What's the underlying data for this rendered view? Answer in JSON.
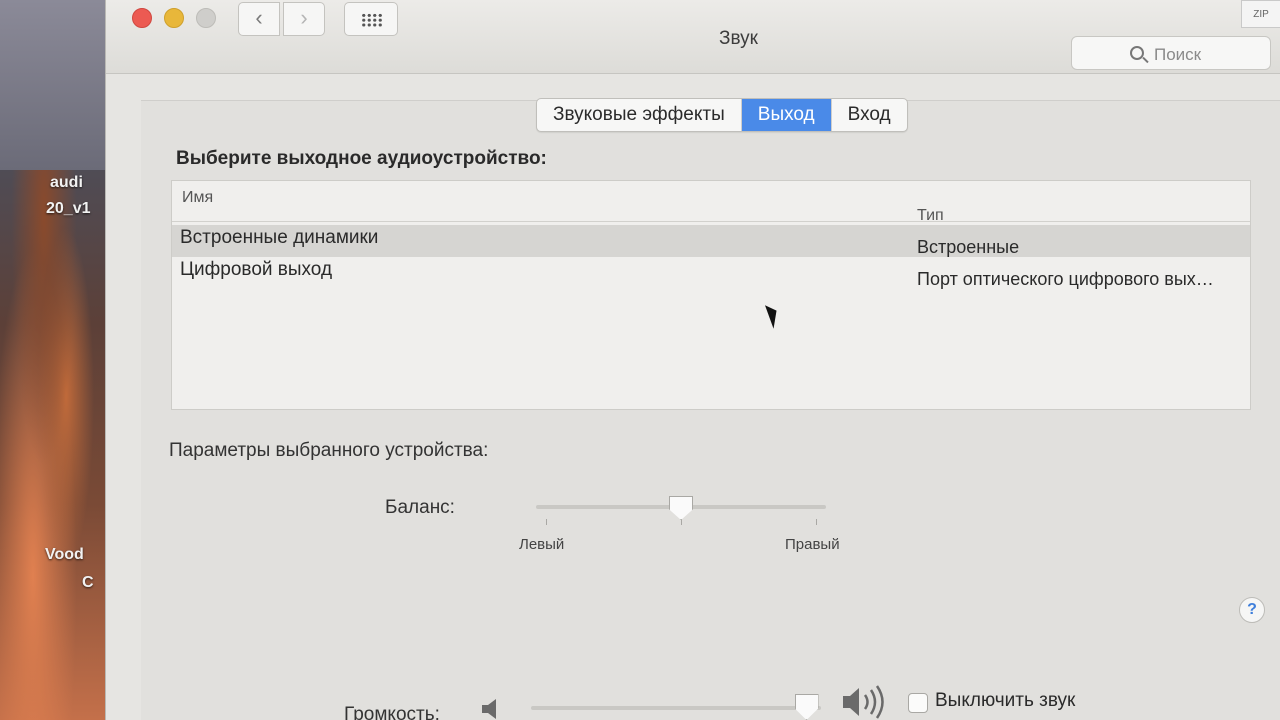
{
  "desktop": {
    "icon_label_line1": "audi",
    "icon_label_line2": "20_v1",
    "icon2_label_line1": "Vood",
    "icon2_label_line2": "C"
  },
  "window": {
    "title": "Звук",
    "search_placeholder": "Поиск",
    "zip_badge": "ZIP",
    "back_glyph": "‹",
    "forward_glyph": "›"
  },
  "tabs": [
    {
      "label": "Звуковые эффекты",
      "active": false
    },
    {
      "label": "Выход",
      "active": true
    },
    {
      "label": "Вход",
      "active": false
    }
  ],
  "output": {
    "section_title": "Выберите выходное аудиоустройство:",
    "columns": {
      "name": "Имя",
      "type": "Тип"
    },
    "devices": [
      {
        "name": "Встроенные динамики",
        "type": "Встроенные",
        "selected": true
      },
      {
        "name": "Цифровой выход",
        "type": "Порт оптического цифрового вых…",
        "selected": false
      }
    ]
  },
  "params": {
    "section_title": "Параметры выбранного устройства:",
    "balance_label": "Баланс:",
    "balance_left": "Левый",
    "balance_right": "Правый",
    "balance_value": 0.5
  },
  "help": {
    "glyph": "?"
  },
  "volume": {
    "label": "Громкость:",
    "level": 0.95,
    "mute_label": "Выключить звук",
    "muted": false
  }
}
